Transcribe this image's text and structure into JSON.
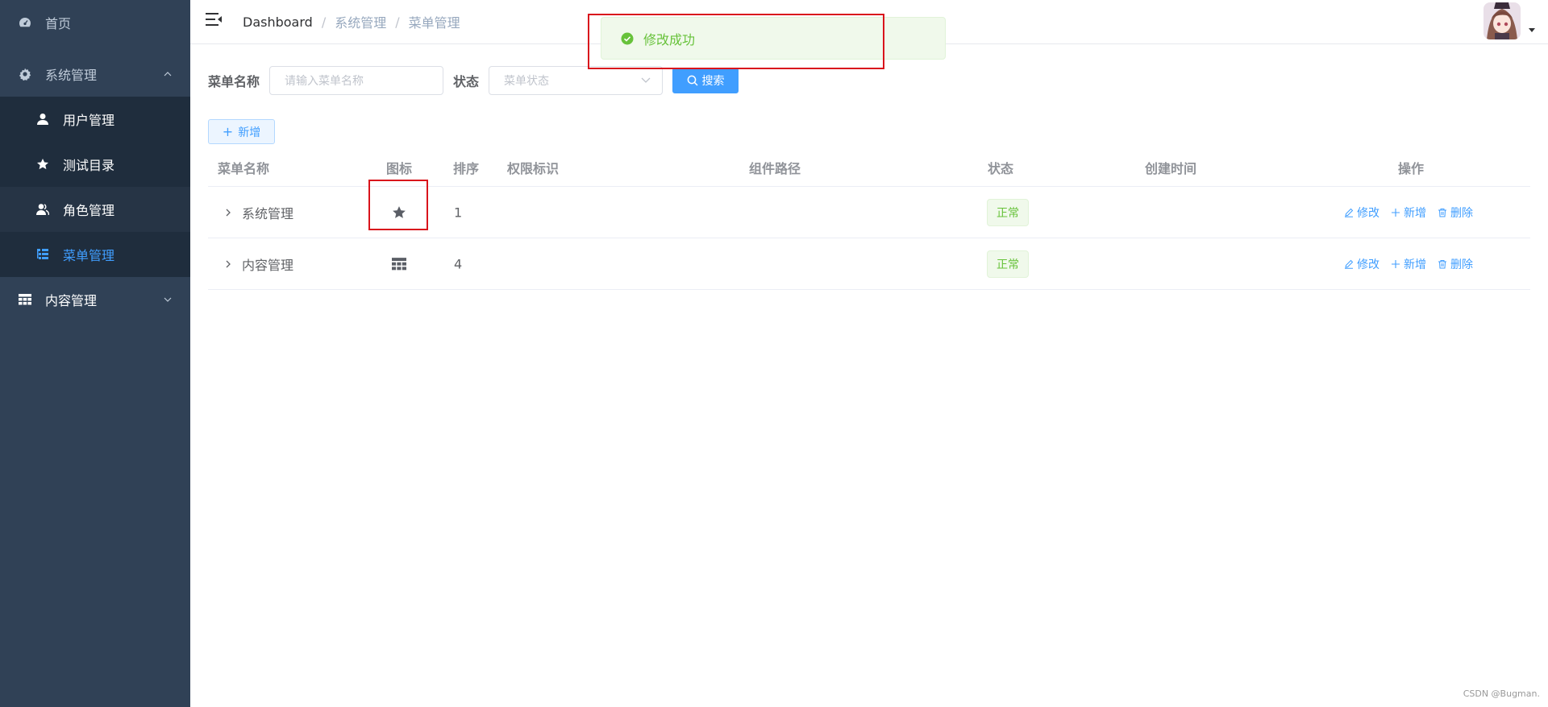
{
  "sidebar": {
    "home": "首页",
    "system": "系统管理",
    "items": [
      {
        "label": "用户管理"
      },
      {
        "label": "测试目录"
      },
      {
        "label": "角色管理"
      },
      {
        "label": "菜单管理"
      }
    ],
    "content": "内容管理"
  },
  "header": {
    "breadcrumb": [
      "Dashboard",
      "系统管理",
      "菜单管理"
    ],
    "separator": "/"
  },
  "search": {
    "name_label": "菜单名称",
    "name_placeholder": "请输入菜单名称",
    "status_label": "状态",
    "status_placeholder": "菜单状态",
    "search_button": "搜索"
  },
  "toolbar": {
    "add_label": "新增"
  },
  "table": {
    "headers": [
      "菜单名称",
      "图标",
      "排序",
      "权限标识",
      "组件路径",
      "状态",
      "创建时间",
      "操作"
    ],
    "rows": [
      {
        "name": "系统管理",
        "icon": "star-icon",
        "order": "1",
        "perms": "",
        "component": "",
        "status": "正常",
        "created": ""
      },
      {
        "name": "内容管理",
        "icon": "table-icon",
        "order": "4",
        "perms": "",
        "component": "",
        "status": "正常",
        "created": ""
      }
    ],
    "actions": {
      "edit": "修改",
      "add": "新增",
      "delete": "删除"
    }
  },
  "toast": {
    "message": "修改成功"
  },
  "watermark": "CSDN @Bugman.",
  "colors": {
    "sidebar_bg": "#304156",
    "submenu_bg": "#1f2d3d",
    "accent": "#409eff",
    "success": "#67c23a",
    "highlight_box": "#d9141c"
  }
}
